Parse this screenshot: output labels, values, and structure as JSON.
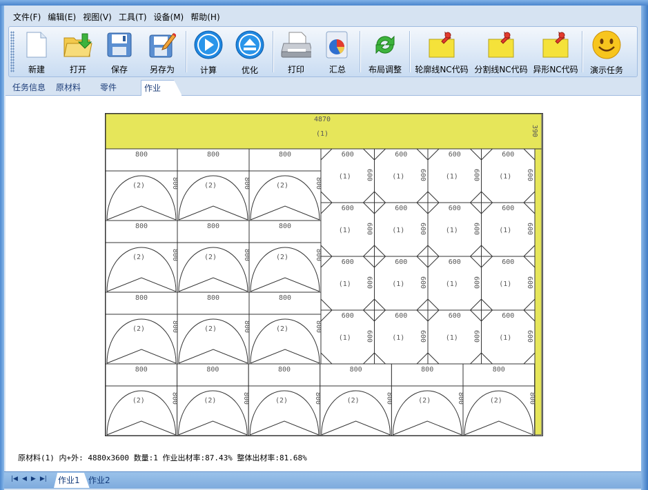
{
  "menu": [
    "文件(F)",
    "编辑(E)",
    "视图(V)",
    "工具(T)",
    "设备(M)",
    "帮助(H)"
  ],
  "toolbar": {
    "buttons": [
      {
        "id": "new",
        "label": "新建",
        "icon": "document-icon"
      },
      {
        "id": "open",
        "label": "打开",
        "icon": "folder-open-icon"
      },
      {
        "id": "save",
        "label": "保存",
        "icon": "floppy-icon"
      },
      {
        "id": "saveas",
        "label": "另存为",
        "icon": "floppy-pencil-icon"
      },
      {
        "id": "calc",
        "label": "计算",
        "icon": "play-icon"
      },
      {
        "id": "optimize",
        "label": "优化",
        "icon": "eject-icon"
      },
      {
        "id": "print",
        "label": "打印",
        "icon": "printer-icon"
      },
      {
        "id": "summary",
        "label": "汇总",
        "icon": "pie-report-icon"
      },
      {
        "id": "relayout",
        "label": "布局调整",
        "icon": "refresh-arrows-icon"
      },
      {
        "id": "contour_nc",
        "label": "轮廓线NC代码",
        "icon": "pinned-note-icon"
      },
      {
        "id": "split_nc",
        "label": "分割线NC代码",
        "icon": "pinned-note-icon"
      },
      {
        "id": "shape_nc",
        "label": "异形NC代码",
        "icon": "pinned-note-icon"
      },
      {
        "id": "demo",
        "label": "演示任务",
        "icon": "smiley-icon"
      }
    ]
  },
  "tabs": [
    "任务信息",
    "原材料",
    "零件",
    "作业"
  ],
  "active_tab": "作业",
  "sheet": {
    "top_strip": {
      "width_label": "4870",
      "id_label": "(1)",
      "height_label": "390"
    },
    "part2": {
      "width": "800",
      "height": "800",
      "id": "(2)"
    },
    "part1": {
      "width": "600",
      "height": "600",
      "id": "(1)"
    }
  },
  "status": "原材料(1) 内+外: 4880x3600  数量:1  作业出材率:87.43%  整体出材率:81.68%",
  "bottom": {
    "nav": [
      "|◀",
      "◀",
      "▶",
      "▶|"
    ],
    "jobs": [
      "作业1",
      "作业2"
    ]
  },
  "colors": {
    "strip": "#e6e65a",
    "accent": "#4b86cd"
  }
}
